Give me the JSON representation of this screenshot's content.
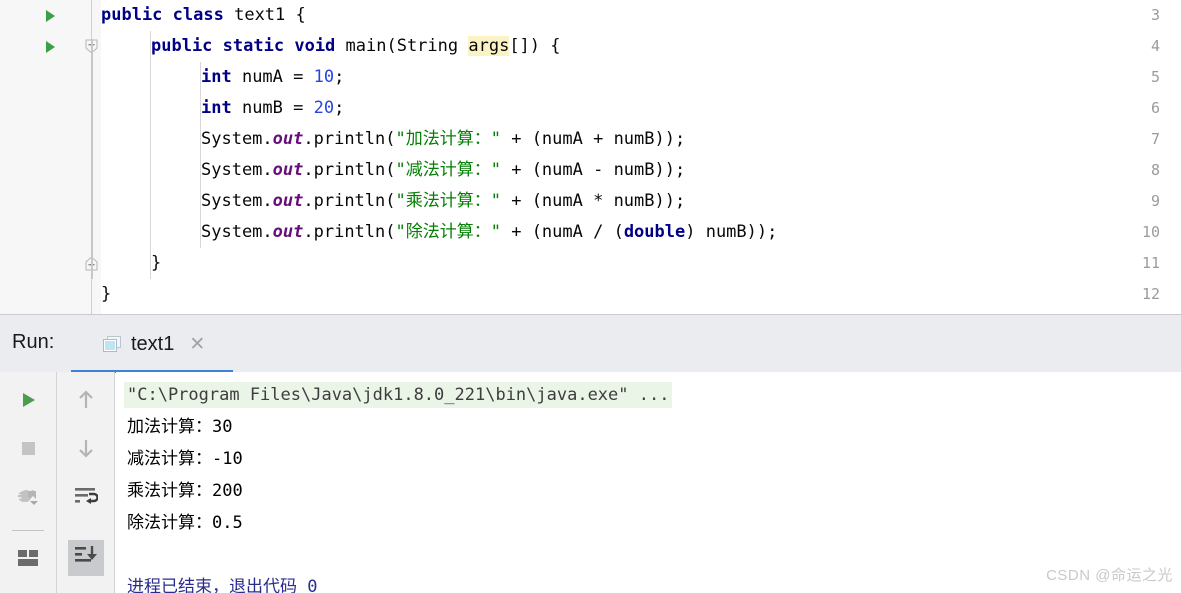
{
  "editor": {
    "gutter": {
      "line_numbers": [
        "3",
        "4",
        "5",
        "6",
        "7",
        "8",
        "9",
        "10",
        "11",
        "12"
      ],
      "run_marker_lines": [
        "3",
        "4"
      ],
      "fold_marker_lines": [
        "4",
        "11"
      ]
    },
    "lines": [
      {
        "number": "3",
        "indent": 0,
        "segments": [
          {
            "t": "public",
            "c": "kw"
          },
          {
            "t": " ",
            "c": ""
          },
          {
            "t": "class",
            "c": "kw"
          },
          {
            "t": " text1 {",
            "c": ""
          }
        ]
      },
      {
        "number": "4",
        "indent": 1,
        "segments": [
          {
            "t": "public",
            "c": "kw"
          },
          {
            "t": " ",
            "c": ""
          },
          {
            "t": "static",
            "c": "kw"
          },
          {
            "t": " ",
            "c": ""
          },
          {
            "t": "void",
            "c": "kw"
          },
          {
            "t": " main(String ",
            "c": ""
          },
          {
            "t": "args",
            "c": "hl"
          },
          {
            "t": "[]) {",
            "c": ""
          }
        ]
      },
      {
        "number": "5",
        "indent": 2,
        "segments": [
          {
            "t": "int",
            "c": "kw"
          },
          {
            "t": " numA = ",
            "c": ""
          },
          {
            "t": "10",
            "c": "num"
          },
          {
            "t": ";",
            "c": ""
          }
        ]
      },
      {
        "number": "6",
        "indent": 2,
        "segments": [
          {
            "t": "int",
            "c": "kw"
          },
          {
            "t": " numB = ",
            "c": ""
          },
          {
            "t": "20",
            "c": "num"
          },
          {
            "t": ";",
            "c": ""
          }
        ]
      },
      {
        "number": "7",
        "indent": 2,
        "segments": [
          {
            "t": "System.",
            "c": ""
          },
          {
            "t": "out",
            "c": "fld"
          },
          {
            "t": ".println(",
            "c": ""
          },
          {
            "t": "\"加法计算：\"",
            "c": "str"
          },
          {
            "t": " + (numA + numB));",
            "c": ""
          }
        ]
      },
      {
        "number": "8",
        "indent": 2,
        "segments": [
          {
            "t": "System.",
            "c": ""
          },
          {
            "t": "out",
            "c": "fld"
          },
          {
            "t": ".println(",
            "c": ""
          },
          {
            "t": "\"减法计算：\"",
            "c": "str"
          },
          {
            "t": " + (numA - numB));",
            "c": ""
          }
        ]
      },
      {
        "number": "9",
        "indent": 2,
        "segments": [
          {
            "t": "System.",
            "c": ""
          },
          {
            "t": "out",
            "c": "fld"
          },
          {
            "t": ".println(",
            "c": ""
          },
          {
            "t": "\"乘法计算：\"",
            "c": "str"
          },
          {
            "t": " + (numA * numB));",
            "c": ""
          }
        ]
      },
      {
        "number": "10",
        "indent": 2,
        "segments": [
          {
            "t": "System.",
            "c": ""
          },
          {
            "t": "out",
            "c": "fld"
          },
          {
            "t": ".println(",
            "c": ""
          },
          {
            "t": "\"除法计算：\"",
            "c": "str"
          },
          {
            "t": " + (numA / (",
            "c": ""
          },
          {
            "t": "double",
            "c": "kw"
          },
          {
            "t": ") numB));",
            "c": ""
          }
        ]
      },
      {
        "number": "11",
        "indent": 1,
        "segments": [
          {
            "t": "}",
            "c": ""
          }
        ]
      },
      {
        "number": "12",
        "indent": 0,
        "segments": [
          {
            "t": "}",
            "c": ""
          }
        ]
      }
    ],
    "colors": {
      "keyword": "#000086",
      "number": "#2a45dd",
      "string": "#048004",
      "static_field": "#660e7a",
      "identifier_highlight": "#fbf3c4",
      "gutter_bg": "#f7f7f7",
      "run_marker": "#3b9f45"
    }
  },
  "run_panel": {
    "label": "Run:",
    "tab": {
      "title": "text1",
      "icon": "run-configuration-icon",
      "close_icon": "✕",
      "active_underline_color": "#3c83d6"
    },
    "toolbar_left": [
      {
        "name": "rerun-button",
        "icon": "play-icon"
      },
      {
        "name": "stop-button",
        "icon": "stop-icon"
      },
      {
        "name": "debug-reattach-button",
        "icon": "bug-arrow-icon"
      },
      {
        "name": "layout-button",
        "icon": "window-layout-icon"
      }
    ],
    "toolbar_right": [
      {
        "name": "up-button",
        "icon": "arrow-up-icon"
      },
      {
        "name": "down-button",
        "icon": "arrow-down-icon"
      },
      {
        "name": "soft-wrap-button",
        "icon": "soft-wrap-icon"
      },
      {
        "name": "scroll-to-end-button",
        "icon": "scroll-to-end-icon",
        "selected": true
      }
    ],
    "console": {
      "command_line": "\"C:\\Program Files\\Java\\jdk1.8.0_221\\bin\\java.exe\" ...",
      "output_lines": [
        "加法计算：30",
        "减法计算：-10",
        "乘法计算：200",
        "除法计算：0.5"
      ],
      "exit_line": "进程已结束，退出代码 0",
      "command_bg": "#eaf5e8",
      "exit_color": "#2b2b8f"
    }
  },
  "watermark": "CSDN @命运之光"
}
